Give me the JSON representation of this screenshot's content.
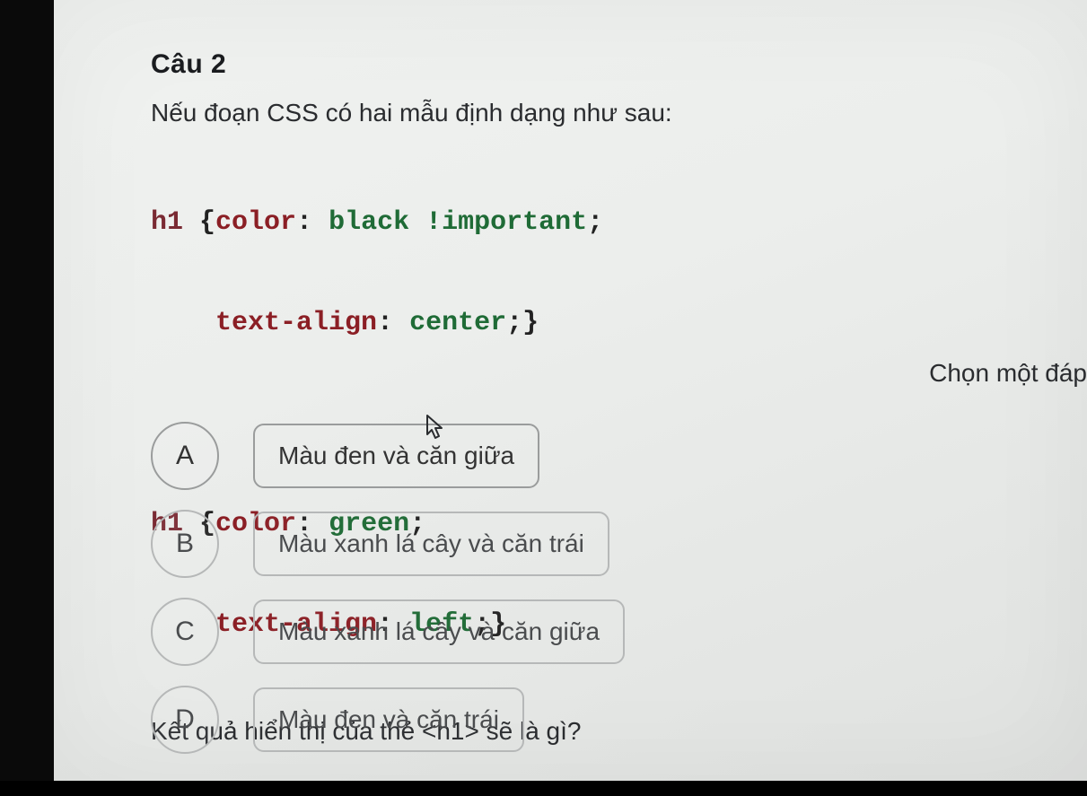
{
  "question": {
    "title": "Câu 2",
    "intro": "Nếu đoạn CSS có hai mẫu định dạng như sau:",
    "code1": {
      "line1": {
        "sel": "h1",
        "open": " {",
        "prop1": "color",
        "colon1": ": ",
        "val1": "black !important",
        "semi1": ";"
      },
      "line2": {
        "prop": "text-align",
        "colon": ": ",
        "val": "center",
        "semi": ";",
        "close": "}"
      }
    },
    "code2": {
      "line1": {
        "sel": "h1",
        "open": " {",
        "prop1": "color",
        "colon1": ": ",
        "val1": "green",
        "semi1": ";"
      },
      "line2": {
        "prop": "text-align",
        "colon": ": ",
        "val": "left",
        "semi": ";",
        "close": "}"
      }
    },
    "outro": "Kết quả hiển thị của thẻ <h1> sẽ là gì?"
  },
  "hint": "Chọn một đáp",
  "options": [
    {
      "letter": "A",
      "text": "Màu đen và căn giữa"
    },
    {
      "letter": "B",
      "text": "Màu xanh lá cây và căn trái"
    },
    {
      "letter": "C",
      "text": "Màu xanh lá cây và căn giữa"
    },
    {
      "letter": "D",
      "text": "Màu đen và căn trái"
    }
  ]
}
